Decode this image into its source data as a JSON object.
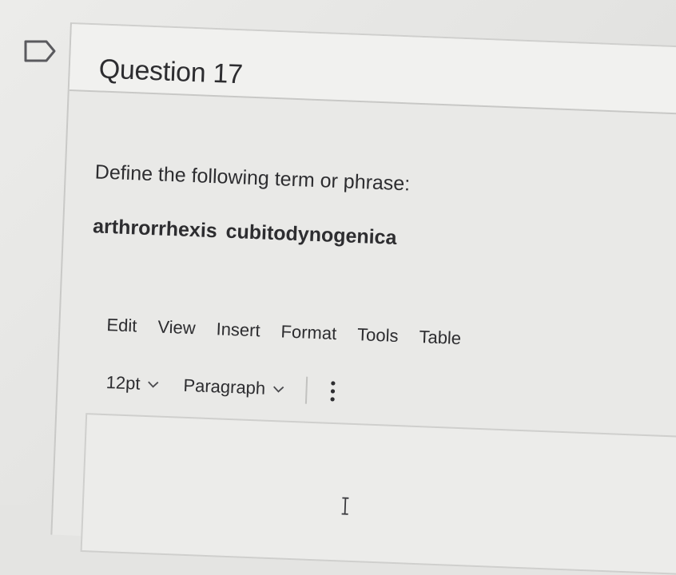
{
  "question": {
    "title": "Question 17",
    "prompt": "Define the following term or phrase:",
    "term": "arthrorrhexis  cubitodynogenica"
  },
  "editor": {
    "menu": [
      "Edit",
      "View",
      "Insert",
      "Format",
      "Tools",
      "Table"
    ],
    "toolbar": {
      "font_size": "12pt",
      "block_format": "Paragraph"
    },
    "content": ""
  },
  "icons": [
    "flag-icon",
    "chevron-down-icon",
    "more-vertical-icon",
    "text-cursor-icon"
  ]
}
